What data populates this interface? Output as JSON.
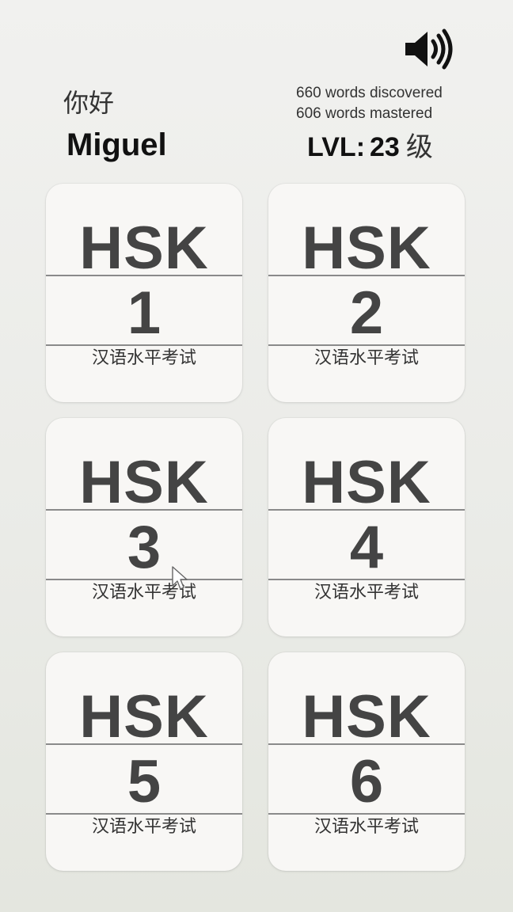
{
  "header": {
    "greeting": "你好",
    "username": "Miguel",
    "stats": {
      "discovered": "660 words discovered",
      "mastered": "606 words mastered"
    },
    "level": {
      "label": "LVL:",
      "value": "23",
      "unit": "级"
    },
    "sound_icon": "speaker-volume-icon"
  },
  "cards": [
    {
      "title": "HSK",
      "number": "1",
      "subtitle": "汉语水平考试"
    },
    {
      "title": "HSK",
      "number": "2",
      "subtitle": "汉语水平考试"
    },
    {
      "title": "HSK",
      "number": "3",
      "subtitle": "汉语水平考试"
    },
    {
      "title": "HSK",
      "number": "4",
      "subtitle": "汉语水平考试"
    },
    {
      "title": "HSK",
      "number": "5",
      "subtitle": "汉语水平考试"
    },
    {
      "title": "HSK",
      "number": "6",
      "subtitle": "汉语水平考试"
    }
  ],
  "colors": {
    "background": "#eceee9",
    "card": "#f8f7f5",
    "card_text": "#444444",
    "divider": "#8a8a8a"
  }
}
